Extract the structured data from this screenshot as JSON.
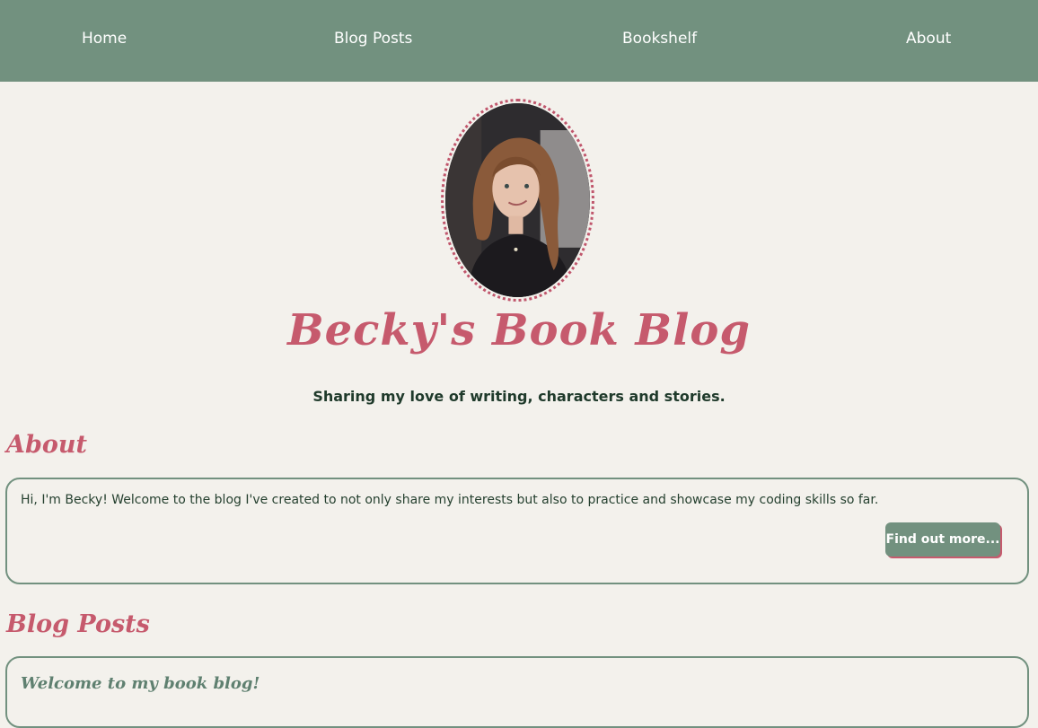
{
  "nav": {
    "items": [
      {
        "label": "Home"
      },
      {
        "label": "Blog Posts"
      },
      {
        "label": "Bookshelf"
      },
      {
        "label": "About"
      }
    ]
  },
  "hero": {
    "title": "Becky's Book Blog",
    "tagline": "Sharing my love of writing, characters and stories."
  },
  "about": {
    "heading": "About",
    "text": "Hi, I'm Becky! Welcome to the blog I've created to not only share my interests but also to practice and showcase my coding skills so far.",
    "button_label": "Find out more..."
  },
  "blog": {
    "heading": "Blog Posts",
    "posts": [
      {
        "title": "Welcome to my book blog!"
      }
    ]
  },
  "colors": {
    "nav_bg": "#72917f",
    "accent_pink": "#c65a6d",
    "page_bg": "#f3f1ec",
    "text_dark": "#1f3a2b"
  }
}
